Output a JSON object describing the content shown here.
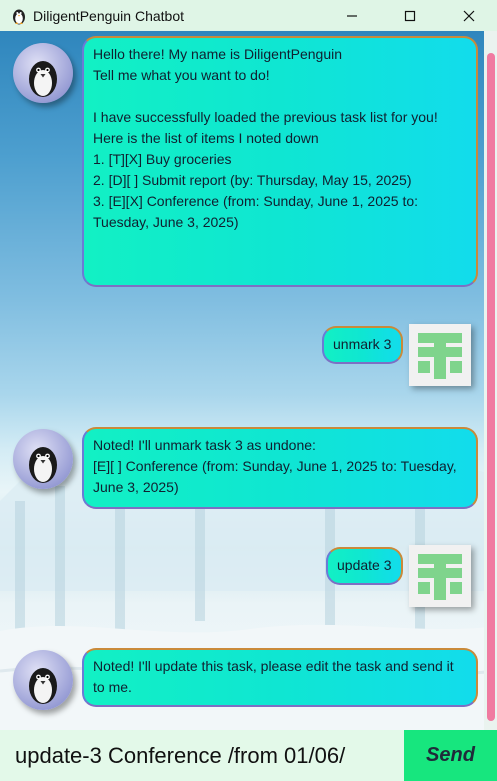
{
  "window": {
    "title": "DiligentPenguin Chatbot"
  },
  "messages": [
    {
      "from": "bot",
      "text": "Hello there! My name is DiligentPenguin\nTell me what you want to do!\n\nI have successfully loaded the previous task list for you!\nHere is the list of items I noted down\n1. [T][X] Buy groceries\n2. [D][ ] Submit report (by: Thursday, May 15, 2025)\n3. [E][X] Conference (from: Sunday, June 1, 2025 to: Tuesday, June 3, 2025)"
    },
    {
      "from": "user",
      "text": "unmark 3"
    },
    {
      "from": "bot",
      "text": "Noted! I'll unmark task 3 as undone:\n[E][ ] Conference (from: Sunday, June 1, 2025 to: Tuesday, June 3, 2025)"
    },
    {
      "from": "user",
      "text": "update 3"
    },
    {
      "from": "bot",
      "text": "Noted! I'll update this task, please edit the task and send it to me."
    }
  ],
  "input": {
    "value": "update-3 Conference /from 01/06/"
  },
  "send": {
    "label": "Send"
  },
  "colors": {
    "send_button": "#17e67e",
    "bubble": "#12e6d8",
    "scroll_thumb": "#f07aa0"
  }
}
